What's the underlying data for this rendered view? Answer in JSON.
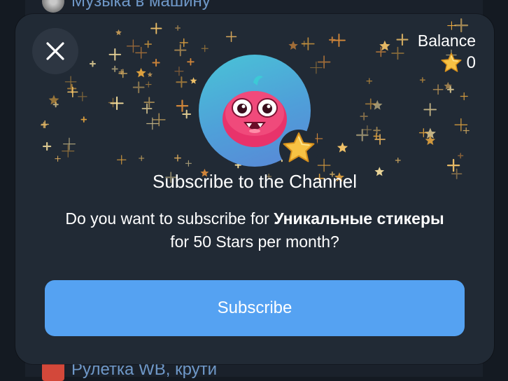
{
  "background": {
    "top_item_label": "Музыка в машину",
    "bottom_item_label": "Рулетка WB, крути"
  },
  "modal": {
    "close_icon": "close-icon",
    "balance": {
      "label": "Balance",
      "amount": "0",
      "icon": "star-icon"
    },
    "avatar_icon": "channel-avatar",
    "title": "Subscribe to the Channel",
    "description": {
      "prefix": "Do you want to subscribe for ",
      "channel_name": "Уникальные стикеры",
      "suffix": " for 50 Stars per month?"
    },
    "subscribe_label": "Subscribe"
  },
  "colors": {
    "accent": "#55a2f2",
    "modal_bg": "#212a35",
    "star_gold": "#f4b43a"
  }
}
